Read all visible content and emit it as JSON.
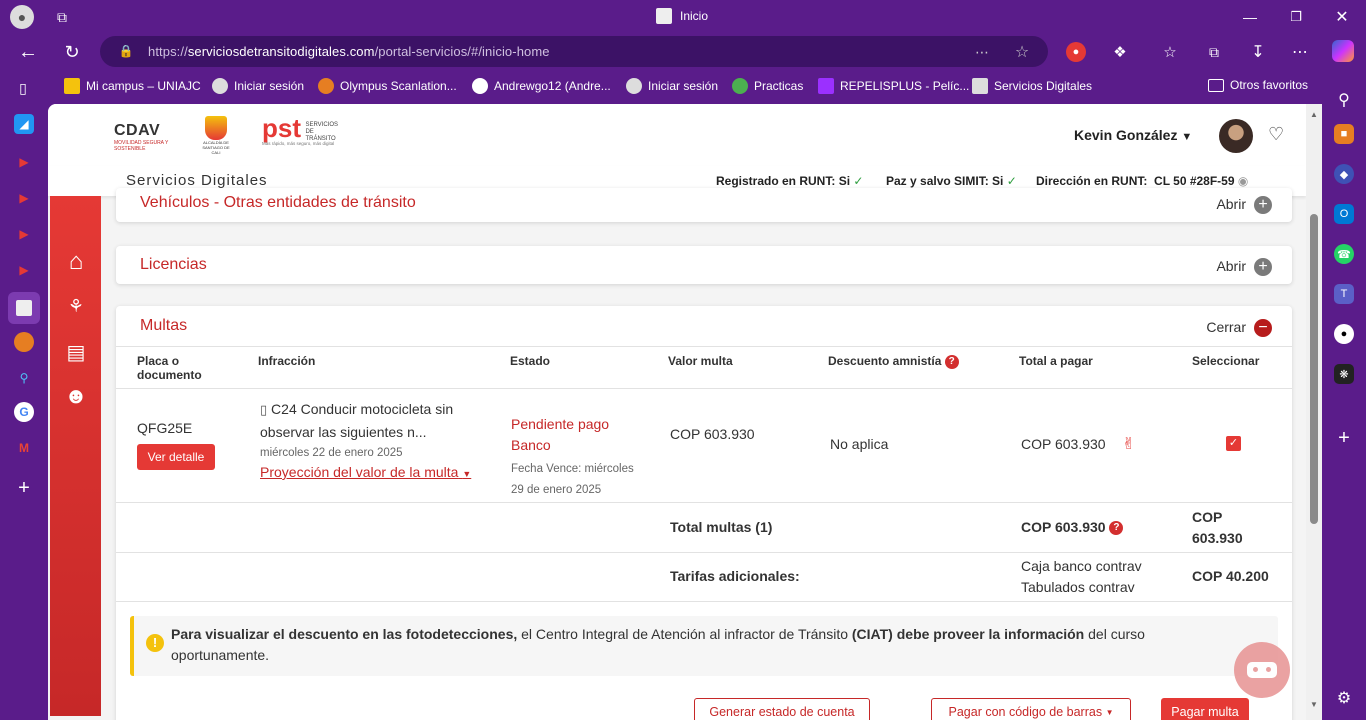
{
  "browser": {
    "tab_title": "Inicio",
    "url_prefix": "https://",
    "url_host": "serviciosdetransitodigitales.com",
    "url_path": "/portal-servicios/#/inicio-home",
    "favorites": [
      {
        "label": "Mi campus – UNIAJC"
      },
      {
        "label": "Iniciar sesión"
      },
      {
        "label": "Olympus Scanlation..."
      },
      {
        "label": "Andrewgo12 (Andre..."
      },
      {
        "label": "Iniciar sesión"
      },
      {
        "label": "Practicas"
      },
      {
        "label": "REPELISPLUS - Pelíc..."
      },
      {
        "label": "Servicios Digitales"
      }
    ],
    "other_favorites": "Otros favoritos"
  },
  "header": {
    "logo_cdav": "CDAV",
    "logo_cdav_sub": "MOVILIDAD SEGURA Y SOSTENIBLE",
    "logo_cali": "ALCALDÍA DE SANTIAGO DE CALI",
    "logo_pst": "pst",
    "logo_pst_sub": "SERVICIOS DE TRÁNSITO",
    "logo_pst_tag": "Más rápido, más seguro, más digital",
    "user_name": "Kevin González"
  },
  "subbar": {
    "title": "Servicios Digitales",
    "runt_label": "Registrado en RUNT:",
    "runt_value": "Si",
    "simit_label": "Paz y salvo SIMIT:",
    "simit_value": "Si",
    "address_label": "Dirección en RUNT:",
    "address_value": "CL 50 #28F-59"
  },
  "sections": {
    "vehiculos": {
      "title": "Vehículos - Otras entidades de tránsito",
      "action": "Abrir"
    },
    "licencias": {
      "title": "Licencias",
      "action": "Abrir"
    },
    "multas": {
      "title": "Multas",
      "action": "Cerrar"
    }
  },
  "table": {
    "headers": {
      "placa": "Placa o documento",
      "infraccion": "Infracción",
      "estado": "Estado",
      "valor": "Valor multa",
      "descuento": "Descuento amnistía",
      "total": "Total a pagar",
      "seleccionar": "Seleccionar"
    },
    "row": {
      "placa": "QFG25E",
      "detail_button": "Ver detalle",
      "infraccion_line1": "C24 Conducir motocicleta sin",
      "infraccion_line2": "observar las siguientes n...",
      "fecha": "miércoles 22 de enero 2025",
      "proyeccion": "Proyección del valor de la multa",
      "estado_line1": "Pendiente pago",
      "estado_line2": "Banco",
      "vence_line1": "Fecha Vence: miércoles",
      "vence_line2": "29 de enero 2025",
      "valor": "COP 603.930",
      "descuento": "No aplica",
      "total": "COP 603.930",
      "selected": true
    },
    "total_multas_label": "Total multas (1)",
    "total_multas_value": "COP 603.930",
    "total_multas_final_1": "COP",
    "total_multas_final_2": "603.930",
    "tarifas_label": "Tarifas adicionales:",
    "tarifa_1": "Caja banco contrav",
    "tarifa_2": "Tabulados contrav",
    "tarifas_value": "COP 40.200"
  },
  "alert": {
    "bold_1": "Para visualizar el descuento en las fotodetecciones,",
    "text_1": " el Centro Integral de Atención al infractor de Tránsito ",
    "bold_2": "(CIAT) debe proveer la información",
    "text_2": " del curso",
    "text_3": "oportunamente."
  },
  "actions": {
    "estado_cuenta": "Generar estado de cuenta",
    "codigo_barras": "Pagar con código de barras",
    "pagar": "Pagar multa"
  },
  "colors": {
    "accent": "#c62828",
    "browser": "#5a1c8a",
    "alert_border": "#f4c20d"
  }
}
